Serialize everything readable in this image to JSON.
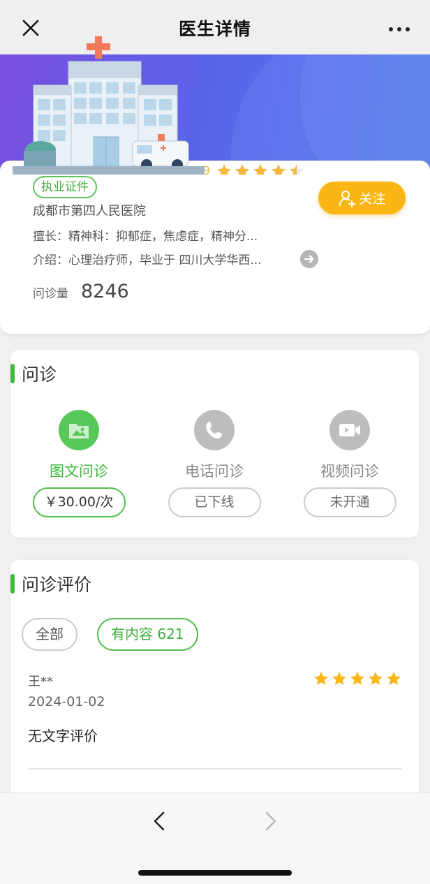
{
  "nav": {
    "title": "医生详情"
  },
  "banner": {
    "rating": "4.9",
    "stars": 4.5
  },
  "profile": {
    "cert_label": "执业证件",
    "hospital": "成都市第四人民医院",
    "specialty": "擅长：精神科：抑郁症，焦虑症，精神分...",
    "intro": "介绍：心理治疗师，毕业于 四川大学华西...",
    "consult_label": "问诊量",
    "consult_count": "8246",
    "follow_label": "关注"
  },
  "consult": {
    "title": "问诊",
    "services": [
      {
        "name": "图文问诊",
        "status": "￥30.00/次",
        "icon": "image-folder-icon"
      },
      {
        "name": "电话问诊",
        "status": "已下线",
        "icon": "phone-icon"
      },
      {
        "name": "视频问诊",
        "status": "未开通",
        "icon": "video-camera-icon"
      }
    ]
  },
  "reviews": {
    "title": "问诊评价",
    "filters": [
      {
        "label": "全部"
      },
      {
        "label": "有内容 621"
      }
    ],
    "items": [
      {
        "user": "王**",
        "date": "2024-01-02",
        "text": "无文字评价",
        "stars": 5
      }
    ]
  },
  "colors": {
    "accent_green": "#3fb83c",
    "star": "#fbb614",
    "follow": "#fbb614"
  }
}
